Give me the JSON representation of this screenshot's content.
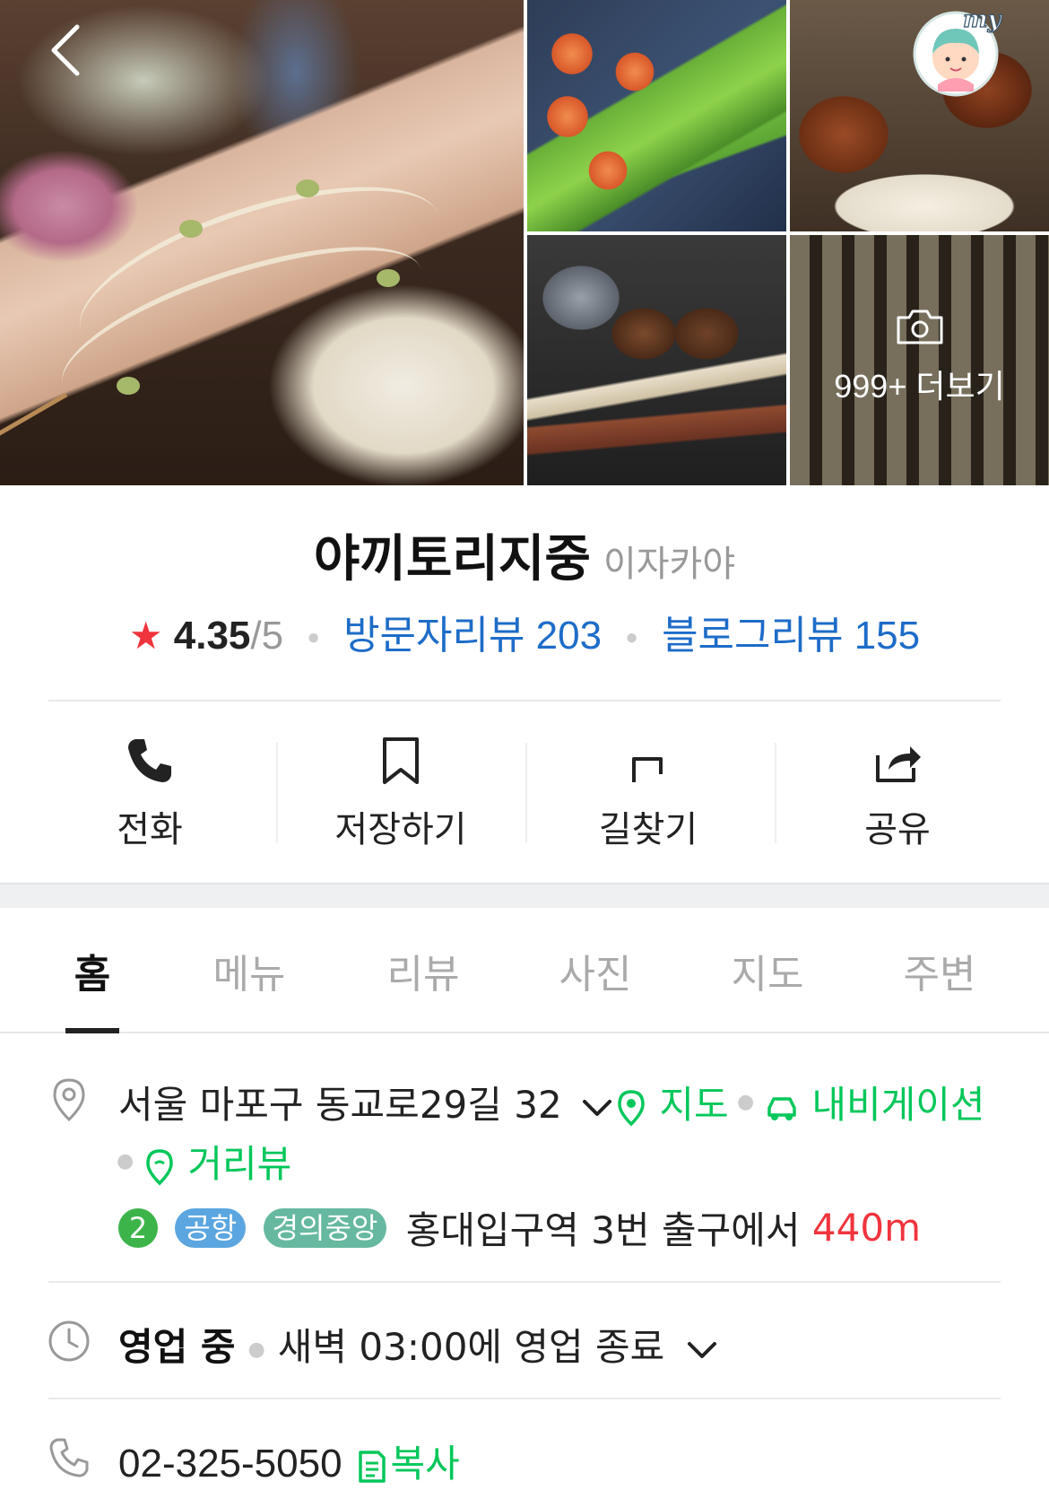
{
  "gallery": {
    "more_label": "999+ 더보기"
  },
  "header": {
    "my_badge_text": "my"
  },
  "place": {
    "name": "야끼토리지중",
    "category": "이자카야",
    "rating": "4.35",
    "rating_max": "/5",
    "visitor_reviews": "방문자리뷰 203",
    "blog_reviews": "블로그리뷰 155"
  },
  "actions": [
    {
      "label": "전화",
      "icon": "phone-icon"
    },
    {
      "label": "저장하기",
      "icon": "bookmark-icon"
    },
    {
      "label": "길찾기",
      "icon": "directions-icon"
    },
    {
      "label": "공유",
      "icon": "share-icon"
    }
  ],
  "tabs": [
    {
      "label": "홈",
      "active": true
    },
    {
      "label": "메뉴",
      "active": false
    },
    {
      "label": "리뷰",
      "active": false
    },
    {
      "label": "사진",
      "active": false
    },
    {
      "label": "지도",
      "active": false
    },
    {
      "label": "주변",
      "active": false
    }
  ],
  "info": {
    "address": "서울 마포구 동교로29길 32",
    "map_link": "지도",
    "navi_link": "내비게이션",
    "street_view_link": "거리뷰",
    "subway": {
      "line_number": "2",
      "tags": [
        "공항",
        "경의중앙"
      ],
      "station_text": "홍대입구역 3번 출구에서",
      "distance": "440m"
    },
    "status": "영업 중",
    "hours_text": "새벽 03:00에 영업 종료",
    "phone": "02-325-5050",
    "copy_label": "복사"
  },
  "colors": {
    "accent_green": "#03c75a",
    "link_blue": "#1e6cc8",
    "star_red": "#f0343d",
    "line2_green": "#3cb44a",
    "airport_blue": "#5ba6e0",
    "gyeongui_teal": "#66b9a0"
  }
}
